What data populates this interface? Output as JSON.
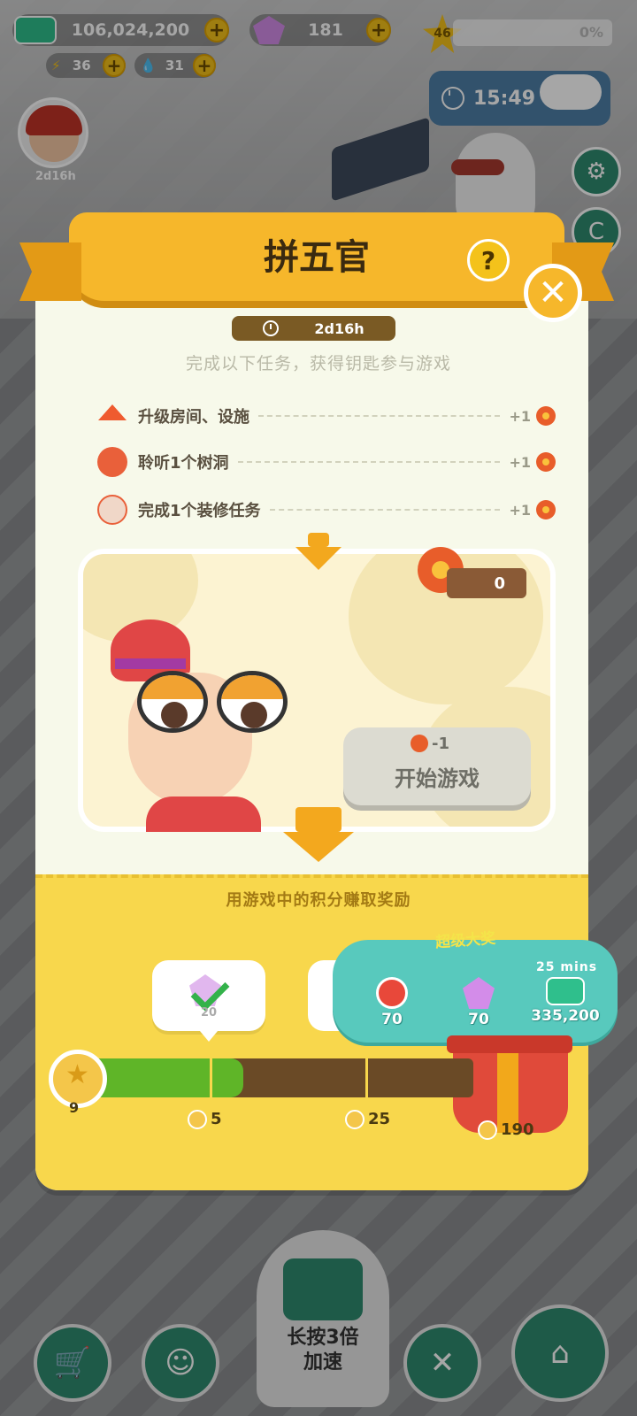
{
  "topbar": {
    "cash": "106,024,200",
    "gems": "181",
    "energy": "36",
    "water": "31",
    "level": "46",
    "xp_percent": "0%",
    "timer": "15:49"
  },
  "avatar": {
    "time": "2d16h"
  },
  "modal": {
    "title": "拼五官",
    "help": "?",
    "close": "✕",
    "countdown": "2d16h",
    "instruction": "完成以下任务，获得钥匙参与游戏",
    "tasks": [
      {
        "label": "升级房间、设施",
        "reward": "+1"
      },
      {
        "label": "聆听1个树洞",
        "reward": "+1"
      },
      {
        "label": "完成1个装修任务",
        "reward": "+1"
      }
    ],
    "keys_owned": "0",
    "start_cost": "-1",
    "start_label": "开始游戏",
    "earn_label": "用游戏中的积分赚取奖励",
    "card_value": "20",
    "super_prize": {
      "title": "超级大奖",
      "time": "25 mins",
      "items": [
        {
          "icon": "flower-icon",
          "value": "70"
        },
        {
          "icon": "gem-icon",
          "value": "70"
        },
        {
          "icon": "cash-icon",
          "value": "335,200"
        }
      ]
    },
    "progress": {
      "current": "9",
      "fill_fraction": 0.41,
      "milestones": [
        "5",
        "25",
        "190"
      ]
    }
  },
  "bottom": {
    "speed_label_1": "长按3倍",
    "speed_label_2": "加速"
  },
  "colors": {
    "banner": "#f6b72b",
    "progress_fill": "#5fb528",
    "super_prize": "#58c9bd"
  }
}
